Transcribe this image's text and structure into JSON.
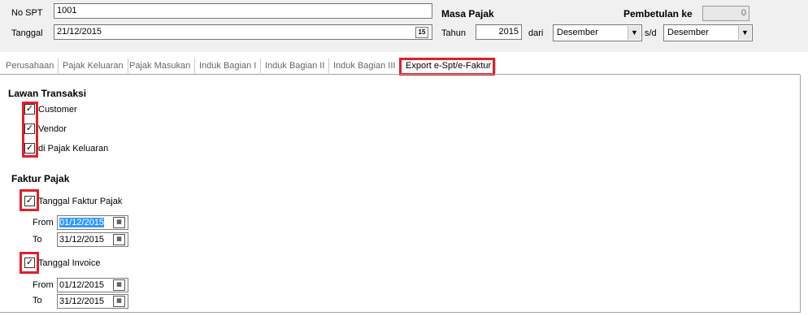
{
  "header": {
    "no_spt_label": "No SPT",
    "no_spt_value": "1001",
    "tanggal_label": "Tanggal",
    "tanggal_value": "21/12/2015",
    "calendar_glyph": "15",
    "masa_pajak_label": "Masa Pajak",
    "tahun_label": "Tahun",
    "tahun_value": "2015",
    "dari_label": "dari",
    "dari_value": "Desember",
    "sd_label": "s/d",
    "sd_value": "Desember",
    "pembetulan_label": "Pembetulan ke",
    "pembetulan_value": "0"
  },
  "tabs": [
    {
      "label": "Perusahaan"
    },
    {
      "label": "Pajak Keluaran"
    },
    {
      "label": "Pajak Masukan"
    },
    {
      "label": "Induk Bagian I"
    },
    {
      "label": "Induk Bagian II"
    },
    {
      "label": "Induk Bagian III"
    },
    {
      "label": "Export e-Spt/e-Faktur",
      "active": true
    }
  ],
  "lawan_transaksi": {
    "title": "Lawan Transaksi",
    "items": [
      {
        "label": "Customer",
        "checked": true
      },
      {
        "label": "Vendor",
        "checked": true
      },
      {
        "label": "di Pajak Keluaran",
        "checked": true
      }
    ]
  },
  "faktur_pajak": {
    "title": "Faktur Pajak",
    "tanggal_faktur": {
      "label": "Tanggal Faktur Pajak",
      "checked": true,
      "from_label": "From",
      "from_value": "01/12/2015",
      "to_label": "To",
      "to_value": "31/12/2015"
    },
    "tanggal_invoice": {
      "label": "Tanggal Invoice",
      "checked": true,
      "from_label": "From",
      "from_value": "01/12/2015",
      "to_label": "To",
      "to_value": "31/12/2015"
    }
  },
  "colors": {
    "highlight": "#e0202a",
    "selection": "#3399ff",
    "panel_bg": "#f0f0f0"
  }
}
